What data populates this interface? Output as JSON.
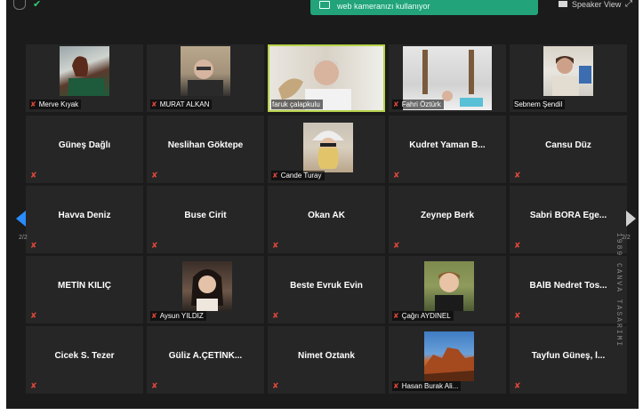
{
  "top_bar": {
    "notification_text": "web kameranızı kullanıyor",
    "speaker_view_label": "Speaker View"
  },
  "pagination": {
    "left": "2/2",
    "right": "2/2"
  },
  "watermark": "1989 CANVA TASARIMI",
  "tiles": [
    {
      "name": "Merve Kıyak"
    },
    {
      "name": "MURAT ALKAN"
    },
    {
      "name": "faruk çalapkulu"
    },
    {
      "name": "Fahri Öztürk"
    },
    {
      "name": "Sebnem Şendil"
    },
    {
      "name": "Güneş Dağlı"
    },
    {
      "name": "Neslihan Göktepe"
    },
    {
      "name": "Cande Turay"
    },
    {
      "name": "Kudret Yaman B..."
    },
    {
      "name": "Cansu Düz"
    },
    {
      "name": "Havva Deniz"
    },
    {
      "name": "Buse Cirit"
    },
    {
      "name": "Okan AK"
    },
    {
      "name": "Zeynep Berk"
    },
    {
      "name": "Sabri BORA   Ege..."
    },
    {
      "name": "METİN KILIÇ"
    },
    {
      "name": "Aysun YILDIZ"
    },
    {
      "name": "Beste Evruk Evin"
    },
    {
      "name": "Çağrı AYDINEL"
    },
    {
      "name": "BAİB Nedret Tos..."
    },
    {
      "name": "Cicek S. Tezer"
    },
    {
      "name": "Güliz  A.ÇETİNK..."
    },
    {
      "name": "Nimet Öztank"
    },
    {
      "name": "Hasan Burak Ali..."
    },
    {
      "name": "Tayfun Güneş, İ..."
    }
  ]
}
